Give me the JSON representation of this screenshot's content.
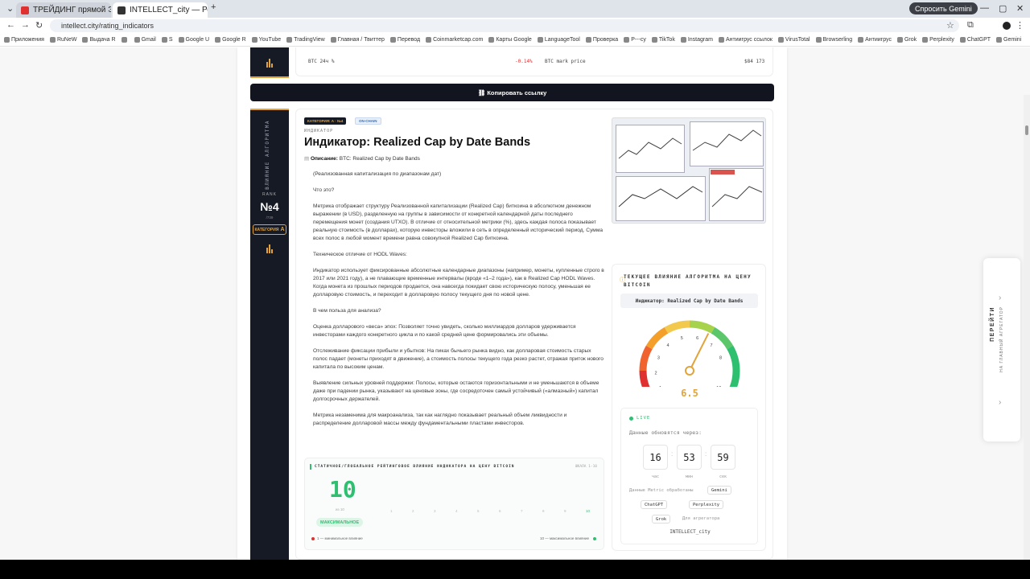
{
  "tabs": [
    {
      "title": "ТРЕЙДИНГ прямой ЭФИР сде",
      "active": false,
      "color": "#e03131"
    },
    {
      "title": "INTELLECT_city — Рейтинг инд",
      "active": true,
      "color": "#333333"
    }
  ],
  "gemini_button": "Спросить Gemini",
  "url": "intellect.city/rating_indicators",
  "bookmarks": [
    "Приложения",
    "RuNeW",
    "Выдача R",
    "",
    "Gmail",
    "S",
    "Google U",
    "Google R",
    "YouTube",
    "TradingView",
    "Главная / Твиттер",
    "Перевод",
    "Coinmarketcap.com",
    "Карты Google",
    "LanguageTool",
    "Проверка",
    "Р---су",
    "TikTok",
    "Instagram",
    "Антиигрус ссылок",
    "VirusTotal",
    "Browserling",
    "Антиигрус",
    "Grok",
    "Perplexity",
    "ChatGPT",
    "Gemini"
  ],
  "top_card": {
    "btc_24h_label": "BTC 24ч %",
    "btc_24h_value": "-0.14%",
    "btc_mark_label": "BTC mark price",
    "btc_mark_value": "$84 173"
  },
  "copy_button": "Копировать ссылку",
  "sidebar": {
    "vertical": "ВЛИЯНИЕ АЛГОРИТМА",
    "rank_label": "RANK",
    "rank": "№4",
    "rank_of": "/739",
    "category_label": "КАТЕГОРИЯ",
    "category": "A"
  },
  "badges": {
    "category": "КАТЕГОРИЯ: A · №4",
    "type": "ON-CHAIN"
  },
  "kicker": "ИНДИКАТОР",
  "title": "Индикатор: Realized Cap by Date Bands",
  "description_label": "Описание:",
  "description_value": "BTC: Realized Cap by Date Bands",
  "body": [
    "(Реализованная капитализация по диапазонам дат)",
    "Что это?",
    "Метрика отображает структуру Реализованной капитализации (Realized Cap) биткоина в абсолютном денежном выражении (в USD), разделенную на группы в зависимости от конкретной календарной даты последнего перемещения монет (создания UTXO). В отличие от относительной метрики (%), здесь каждая полоса показывает реальную стоимость (в долларах), которую инвесторы вложили в сеть в определенный исторический период. Сумма всех полос в любой момент времени равна совокупной Realized Cap биткоина.",
    "Техническое отличие от HODL Waves:",
    "Индикатор использует фиксированные абсолютные календарные диапазоны (например, монеты, купленные строго в 2017 или 2021 году), а не плавающие временные интервалы (вроде «1–2 года»), как в Realized Cap HODL Waves. Когда монета из прошлых периодов продается, она навсегда покидает свою историческую полосу, уменьшая ее долларовую стоимость, и переходит в долларовую полосу текущего дня по новой цене.",
    "В чем польза для анализа?",
    "Оценка долларового «веса» эпох: Позволяет точно увидеть, сколько миллиардов долларов удерживается инвесторами каждого конкретного цикла и по какой средней цене формировались эти объемы.",
    "Отслеживание фиксации прибыли и убытков: На пиках бычьего рынка видно, как долларовая стоимость старых полос падает (монеты приходят в движение), а стоимость полосы текущего года резко растет, отражая приток нового капитала по высоким ценам.",
    "Выявление сильных уровней поддержки: Полосы, которые остаются горизонтальными и не уменьшаются в объеме даже при падении рынка, указывают на ценовые зоны, где сосредоточен самый устойчивый («алмазный») капитал долгосрочных держателей.",
    "Метрика незаменима для макроанализа, так как наглядно показывает реальный объем ликвидности и распределение долларовой массы между фундаментальными пластами инвесторов."
  ],
  "score": {
    "heading": "СТАТИЧНОЕ/ГЛОБАЛЬНОЕ РЕЙТИНГОВОЕ ВЛИЯНИЕ ИНДИКАТОРА НА ЦЕНУ BITCOIN",
    "scale_label": "ШКАЛА 1-10",
    "value": "10",
    "of": "из 10",
    "level": "МАКСИМАЛЬНОЕ",
    "ticks": [
      "1",
      "2",
      "3",
      "4",
      "5",
      "6",
      "7",
      "8",
      "9",
      "10"
    ],
    "min_label": "1 — минимальное влияние",
    "max_label": "10 — максимальное влияние"
  },
  "widget": {
    "title": "ТЕКУЩЕЕ ВЛИЯНИЕ АЛГОРИТМА НА ЦЕНУ BITCOIN",
    "chip": "Индикатор: Realized Cap by Date Bands",
    "gauge_value": 6.5,
    "gauge_text": "6.5",
    "gauge_ticks": [
      "1",
      "2",
      "3",
      "4",
      "5",
      "6",
      "7",
      "8",
      "10"
    ],
    "live": "LIVE",
    "update_label": "Данные обновятся через:",
    "hours": "16",
    "minutes": "53",
    "seconds": "59",
    "hours_label": "час",
    "minutes_label": "мин",
    "seconds_label": "сек",
    "processed_label": "Данные Metric обработаны",
    "agg_label": "Для агрегатора",
    "brand": "INTELLECT_city",
    "providers": [
      "Gemini",
      "ChatGPT",
      "Perplexity",
      "Grok"
    ]
  },
  "right_panel": {
    "title": "ПЕРЕЙТИ",
    "subtitle": "НА ГЛАВНЫЙ АГРЕГАТОР"
  },
  "colors": {
    "accent": "#e2a43a",
    "dark": "#161a25",
    "green": "#2fbf71",
    "red": "#e03131"
  }
}
